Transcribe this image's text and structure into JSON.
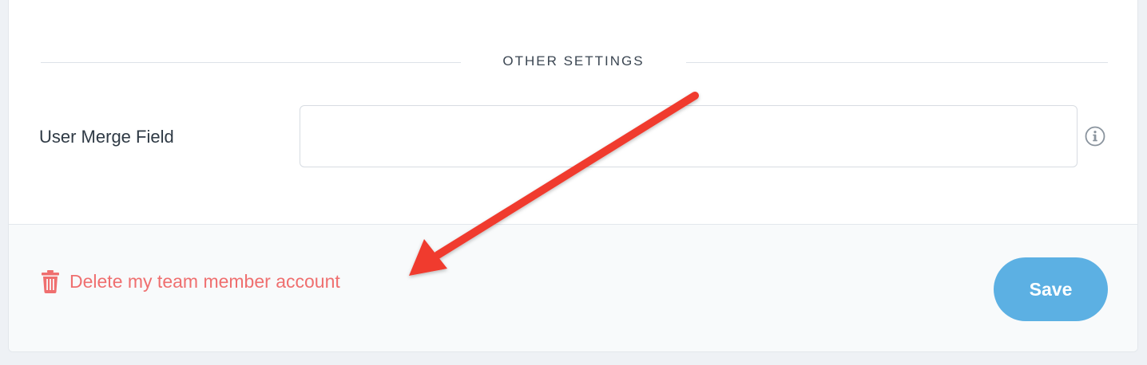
{
  "section": {
    "title": "OTHER SETTINGS"
  },
  "form": {
    "merge_field": {
      "label": "User Merge Field",
      "value": "",
      "placeholder": ""
    },
    "info_icon": "info-circle-icon"
  },
  "footer": {
    "delete_label": "Delete my team member account",
    "delete_icon": "trash-icon",
    "save_label": "Save"
  },
  "colors": {
    "danger": "#ef6f6f",
    "primary": "#5cb0e3",
    "annotation": "#f03a2e"
  }
}
